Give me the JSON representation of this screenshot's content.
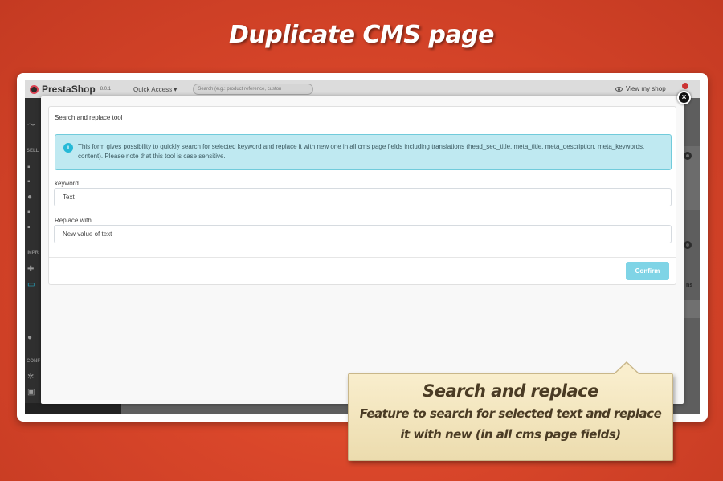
{
  "banner": {
    "title": "Duplicate CMS page"
  },
  "admin": {
    "brand": "PrestaShop",
    "version": "8.0.1",
    "quick_access": "Quick Access ▾",
    "search_placeholder": "Search (e.g.: product reference, custon",
    "view_shop": "View my shop",
    "sidebar_labels": [
      "SELL",
      "IMPR",
      "CONF"
    ],
    "tab_fragment": "ns"
  },
  "modal": {
    "heading": "Search and replace tool",
    "alert_text": "This form gives possibility to quickly search for selected keyword and replace it with new one in all cms page fields including translations (head_seo_title, meta_title, meta_description, meta_keywords, content). Please note that this tool is case sensitive.",
    "keyword_label": "keyword",
    "keyword_value": "Text",
    "replace_label": "Replace with",
    "replace_value": "New value of text",
    "confirm_label": "Confirm",
    "close_symbol": "×"
  },
  "callout": {
    "title": "Search and replace",
    "line1": "Feature to search for selected text and replace",
    "line2": "it with new (in all cms page fields)"
  },
  "colors": {
    "background": "#d9462a",
    "alert_bg": "#bfe9f1",
    "alert_border": "#71cbdb",
    "confirm_bg": "#7fd4e6",
    "callout_bg": "#f9eecd"
  }
}
